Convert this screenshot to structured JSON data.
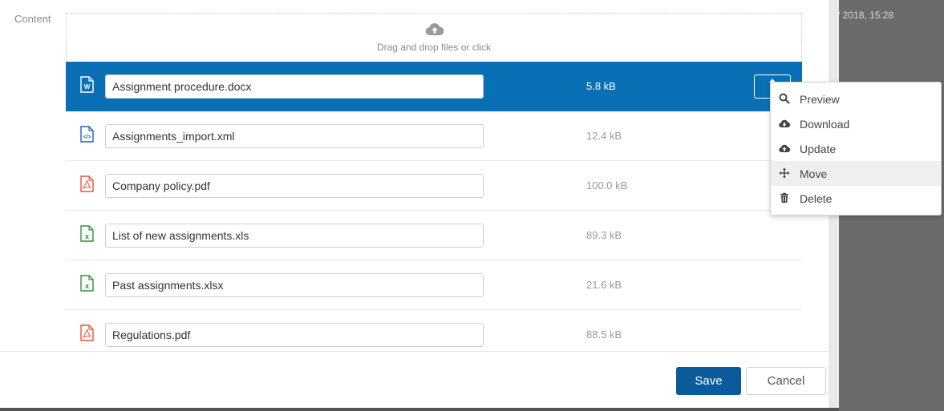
{
  "background": {
    "timestamp": "/ 2018, 15:28"
  },
  "form": {
    "content_label": "Content"
  },
  "dropzone": {
    "text": "Drag and drop files or click",
    "icon": "cloud-upload-icon"
  },
  "files": [
    {
      "name": "Assignment procedure.docx",
      "size": "5.8 kB",
      "type": "word",
      "selected": true
    },
    {
      "name": "Assignments_import.xml",
      "size": "12.4 kB",
      "type": "xml",
      "selected": false
    },
    {
      "name": "Company policy.pdf",
      "size": "100.0 kB",
      "type": "pdf",
      "selected": false
    },
    {
      "name": "List of new assignments.xls",
      "size": "89.3 kB",
      "type": "excel",
      "selected": false
    },
    {
      "name": "Past assignments.xlsx",
      "size": "21.6 kB",
      "type": "excel",
      "selected": false
    },
    {
      "name": "Regulations.pdf",
      "size": "88.5 kB",
      "type": "pdf",
      "selected": false
    }
  ],
  "context_menu": {
    "items": [
      {
        "label": "Preview",
        "icon": "search-icon"
      },
      {
        "label": "Download",
        "icon": "cloud-download-icon"
      },
      {
        "label": "Update",
        "icon": "cloud-upload-icon"
      },
      {
        "label": "Move",
        "icon": "move-icon"
      },
      {
        "label": "Delete",
        "icon": "trash-icon"
      }
    ]
  },
  "footer": {
    "save_label": "Save",
    "cancel_label": "Cancel"
  },
  "colors": {
    "accent": "#0a70b6",
    "save_button": "#0a5a9c",
    "pdf": "#e8533f",
    "excel": "#2f8f3f",
    "word": "#1f63b5"
  }
}
